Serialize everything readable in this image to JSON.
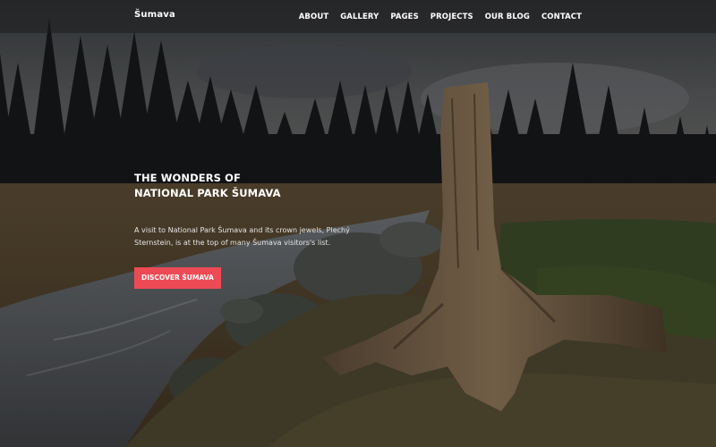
{
  "header": {
    "brand": "Šumava",
    "nav": [
      "ABOUT",
      "GALLERY",
      "PAGES",
      "PROJECTS",
      "OUR BLOG",
      "CONTACT"
    ]
  },
  "hero": {
    "title_line1": "THE WONDERS OF",
    "title_line2": "NATIONAL PARK ŠUMAVA",
    "description": "A visit to National Park Šumava and its crown jewels, Plechý Sternstein, is at the top of many Šumava visitors's list.",
    "cta_label": "DISCOVER ŠUMAVA"
  },
  "colors": {
    "cta_background": "#ee4a55",
    "nav_text": "#ffffff",
    "header_overlay": "rgba(30,30,30,0.55)"
  }
}
